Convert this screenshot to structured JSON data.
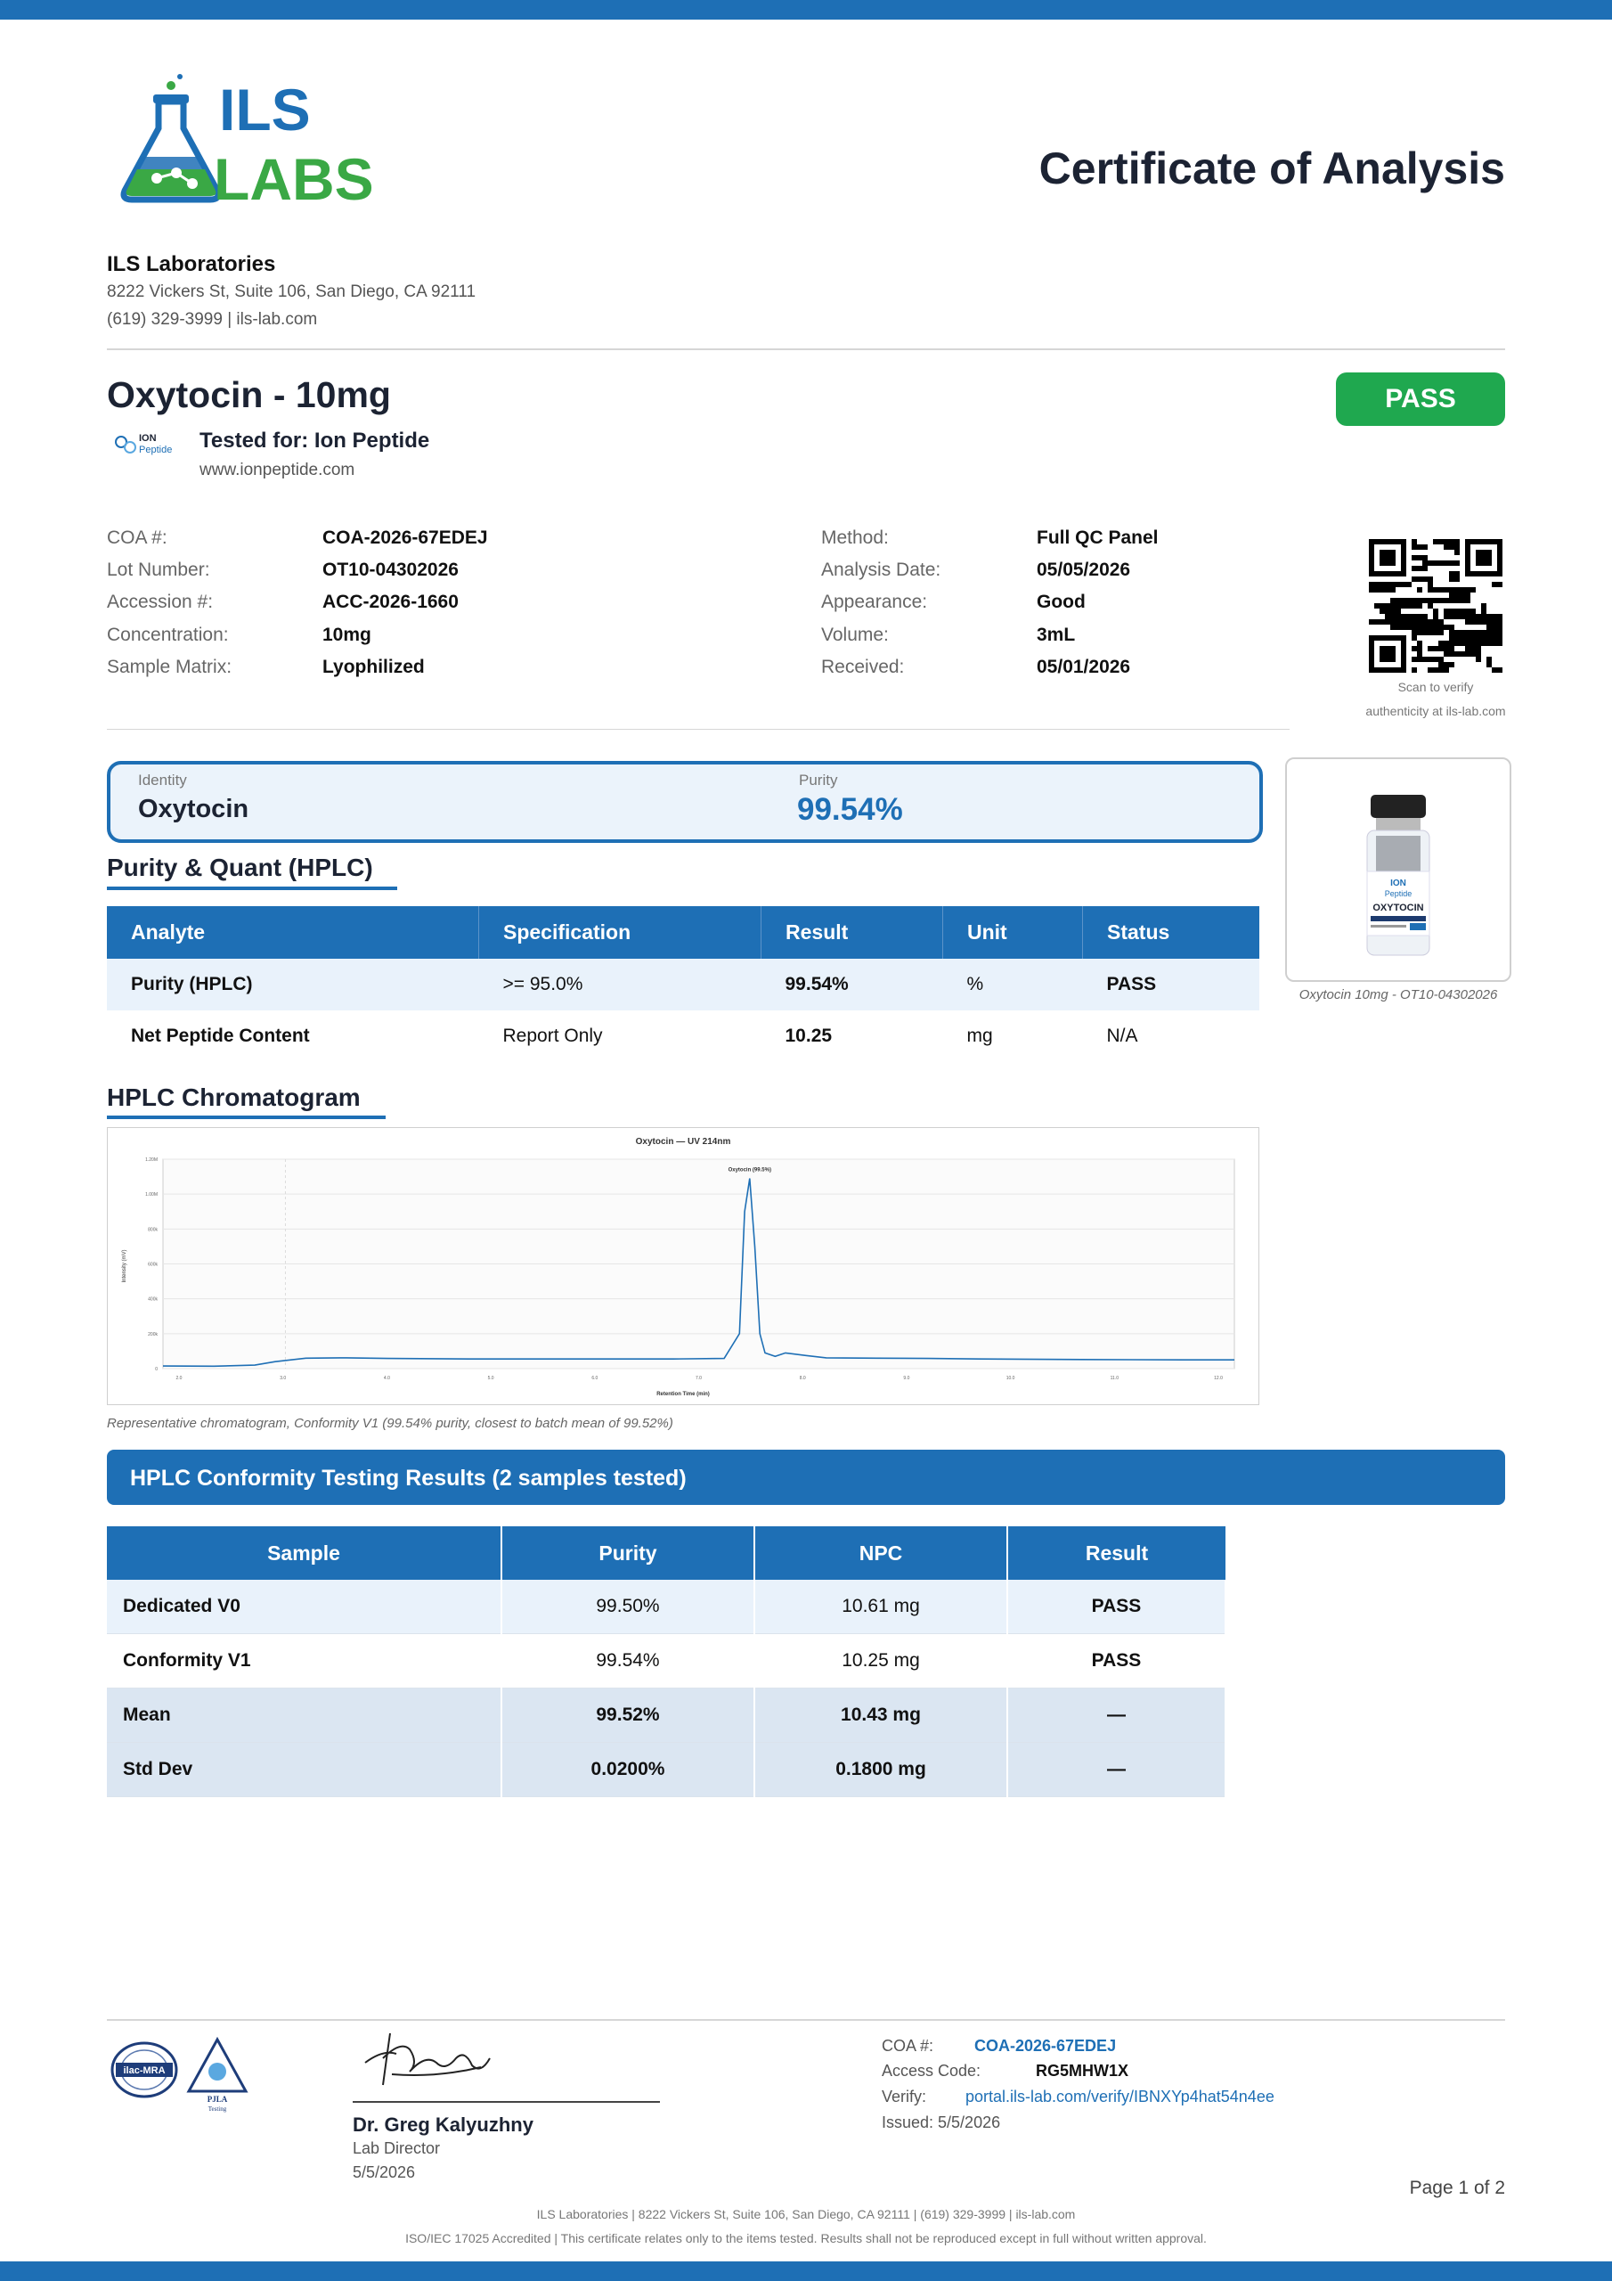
{
  "document": {
    "title": "Certificate of Analysis",
    "lab": {
      "name": "ILS Laboratories",
      "logo_text_top": "ILS",
      "logo_text_bottom": "LABS",
      "address": "8222 Vickers St, Suite 106, San Diego, CA 92111",
      "contact": "(619) 329-3999  |  ils-lab.com"
    },
    "product": {
      "name": "Oxytocin - 10mg",
      "status": "PASS",
      "tested_for": "Tested for: Ion Peptide",
      "client_logo_top": "ION",
      "client_logo_bottom": "Peptide",
      "client_url": "www.ionpeptide.com"
    },
    "meta_left": [
      {
        "label": "COA #:",
        "value": "COA-2026-67EDEJ"
      },
      {
        "label": "Lot Number:",
        "value": "OT10-04302026"
      },
      {
        "label": "Accession #:",
        "value": "ACC-2026-1660"
      },
      {
        "label": "Concentration:",
        "value": "10mg"
      },
      {
        "label": "Sample Matrix:",
        "value": "Lyophilized"
      }
    ],
    "meta_right": [
      {
        "label": "Method:",
        "value": "Full QC Panel"
      },
      {
        "label": "Analysis Date:",
        "value": "05/05/2026"
      },
      {
        "label": "Appearance:",
        "value": "Good"
      },
      {
        "label": "Volume:",
        "value": "3mL"
      },
      {
        "label": "Received:",
        "value": "05/01/2026"
      }
    ],
    "qr": {
      "line1": "Scan to verify",
      "line2": "authenticity at ils-lab.com"
    },
    "summary": {
      "identity_label": "Identity",
      "identity_value": "Oxytocin",
      "purity_label": "Purity",
      "purity_value": "99.54%"
    },
    "vial": {
      "label_top": "ION",
      "label_mid": "Peptide",
      "label_name": "OXYTOCIN",
      "caption": "Oxytocin 10mg - OT10-04302026"
    },
    "purity_section": {
      "title": "Purity & Quant (HPLC)",
      "headers": [
        "Analyte",
        "Specification",
        "Result",
        "Unit",
        "Status"
      ],
      "rows": [
        [
          "Purity (HPLC)",
          ">= 95.0%",
          "99.54%",
          "%",
          "PASS"
        ],
        [
          "Net Peptide Content",
          "Report Only",
          "10.25",
          "mg",
          "N/A"
        ]
      ]
    },
    "chromatogram": {
      "title": "HPLC Chromatogram",
      "caption": "Representative chromatogram, Conformity V1 (99.54% purity, closest to batch mean of 99.52%)"
    },
    "conformity": {
      "title": "HPLC Conformity Testing Results (2 samples tested)",
      "headers": [
        "Sample",
        "Purity",
        "NPC",
        "Result"
      ],
      "rows": [
        [
          "Dedicated V0",
          "99.50%",
          "10.61 mg",
          "PASS"
        ],
        [
          "Conformity V1",
          "99.54%",
          "10.25 mg",
          "PASS"
        ],
        [
          "Mean",
          "99.52%",
          "10.43 mg",
          "—"
        ],
        [
          "Std Dev",
          "0.0200%",
          "0.1800 mg",
          "—"
        ]
      ]
    },
    "signature": {
      "name": "Dr. Greg Kalyuzhny",
      "role": "Lab Director",
      "date": "5/5/2026"
    },
    "accreditation": {
      "ilac": "ilac-MRA",
      "pjla": "PJLA",
      "pjla_sub": "Testing"
    },
    "footer_meta": {
      "coa_label": "COA #:",
      "coa_value": "COA-2026-67EDEJ",
      "access_label": "Access Code:",
      "access_value": "RG5MHW1X",
      "verify_label": "Verify:",
      "verify_value": "portal.ils-lab.com/verify/IBNXYp4hat54n4ee",
      "issued": "Issued: 5/5/2026"
    },
    "page": "Page 1 of 2",
    "footer_line1": "ILS Laboratories  |  8222 Vickers St, Suite 106, San Diego, CA 92111  |  (619) 329-3999  |  ils-lab.com",
    "footer_line2": "ISO/IEC 17025 Accredited  |  This certificate relates only to the items tested. Results shall not be reproduced except in full without written approval."
  },
  "colors": {
    "brand_blue": "#1e6fb5",
    "pass_green": "#1fa84f",
    "logo_green": "#3aa845"
  },
  "chart_data": {
    "type": "line",
    "title": "Oxytocin — UV 214nm",
    "xlabel": "Retention Time (min)",
    "ylabel": "Intensity (mV)",
    "xlim": [
      1.0,
      11.5
    ],
    "ylim": [
      0,
      1200
    ],
    "xticks": [
      "2.0",
      "3.0",
      "4.0",
      "5.0",
      "6.0",
      "7.0",
      "8.0",
      "9.0",
      "10.0",
      "11.0",
      "12.0"
    ],
    "yticks": [
      "0",
      "200k",
      "400k",
      "600k",
      "800k",
      "1.00M",
      "1.20M"
    ],
    "peak_label": "Oxytocin (99.5%)",
    "x": [
      1.0,
      1.5,
      1.9,
      2.1,
      2.4,
      2.8,
      3.2,
      4.0,
      5.0,
      6.0,
      6.5,
      6.65,
      6.7,
      6.75,
      6.8,
      6.85,
      6.9,
      7.0,
      7.1,
      7.3,
      7.5,
      8.0,
      8.5,
      9.0,
      10.0,
      11.0,
      11.5
    ],
    "y": [
      15,
      14,
      20,
      40,
      60,
      62,
      58,
      55,
      55,
      55,
      58,
      200,
      900,
      1090,
      700,
      200,
      90,
      70,
      90,
      75,
      62,
      60,
      58,
      55,
      52,
      50,
      50
    ]
  }
}
